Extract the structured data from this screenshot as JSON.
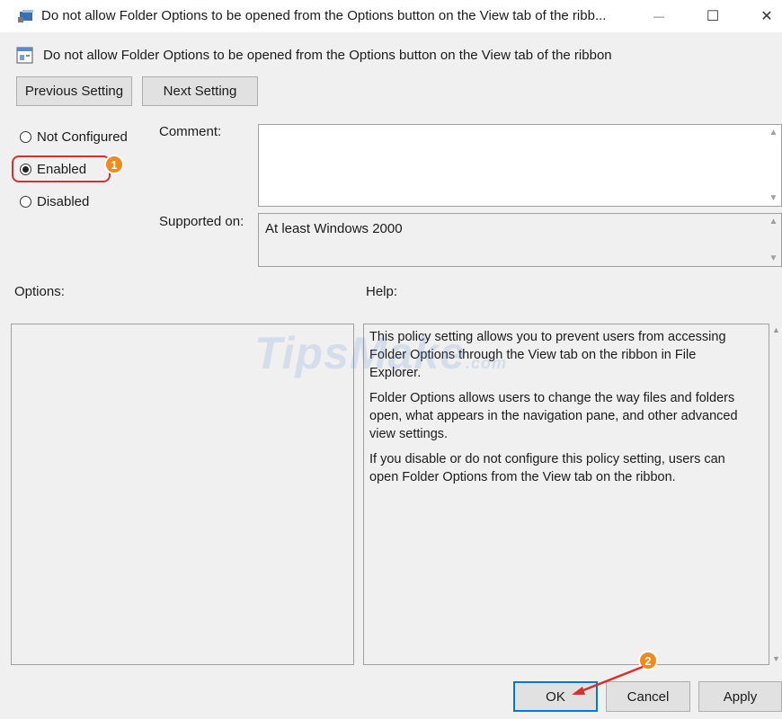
{
  "window": {
    "title": "Do not allow Folder Options to be opened from the Options button on the View tab of the ribb...",
    "app_icon": "gpedit-icon",
    "controls": {
      "minimize": "—",
      "maximize": "☐",
      "close": "✕"
    }
  },
  "header": {
    "icon": "policy-icon",
    "title": "Do not allow Folder Options to be opened from the Options button on the View tab of the ribbon"
  },
  "nav": {
    "previous_label": "Previous Setting",
    "next_label": "Next Setting"
  },
  "state": {
    "selected": "Enabled",
    "options": [
      {
        "label": "Not Configured"
      },
      {
        "label": "Enabled"
      },
      {
        "label": "Disabled"
      }
    ]
  },
  "comment": {
    "label": "Comment:",
    "value": ""
  },
  "supported": {
    "label": "Supported on:",
    "value": "At least Windows 2000"
  },
  "options_panel": {
    "label": "Options:"
  },
  "help_panel": {
    "label": "Help:",
    "paragraphs": [
      "This policy setting allows you to prevent users from accessing Folder Options through the View tab on the ribbon in File Explorer.",
      "Folder Options allows users to change the way files and folders open, what appears in the navigation pane, and other advanced view settings.",
      "If you disable or do not configure this policy setting, users can open Folder Options from the View tab on the ribbon."
    ]
  },
  "footer": {
    "ok_label": "OK",
    "cancel_label": "Cancel",
    "apply_label": "Apply"
  },
  "annotations": {
    "step1": "1",
    "step2": "2",
    "color": "#f08a1c",
    "highlight_color": "#d62f2f"
  },
  "watermark": {
    "text": "TipsMake",
    "suffix": ".com"
  }
}
